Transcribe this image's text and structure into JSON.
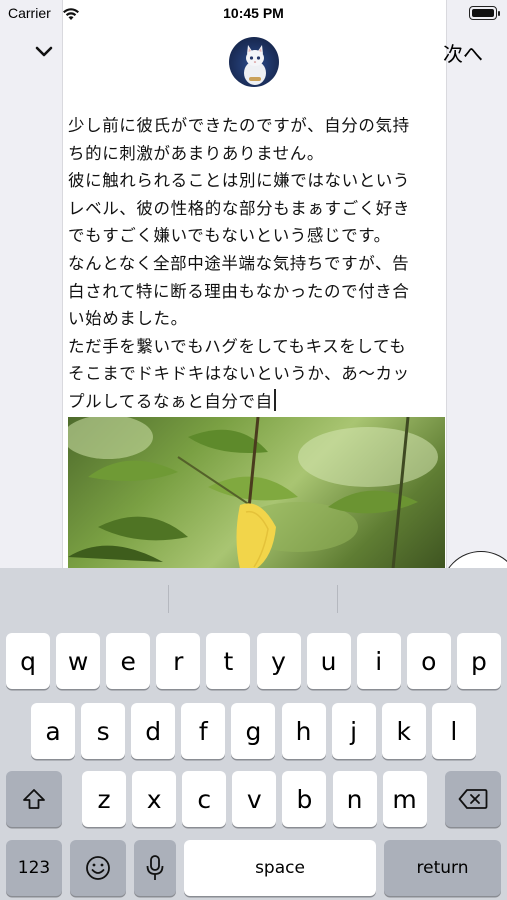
{
  "status_bar": {
    "carrier": "Carrier",
    "time": "10:45 PM"
  },
  "nav": {
    "next_label": "次へ"
  },
  "post": {
    "lines": [
      "少し前に彼氏ができたのですが、自分の気持",
      "ち的に刺激があまりありません。",
      "彼に触れられることは別に嫌ではないという",
      "レベル、彼の性格的な部分もまぁすごく好き",
      "でもすごく嫌いでもないという感じです。",
      "なんとなく全部中途半端な気持ちですが、告",
      "白されて特に断る理由もなかったので付き合",
      "い始めました。",
      "ただ手を繋いでもハグをしてもキスをしても",
      "そこまでドキドキはないというか、あ〜カッ",
      "プルしてるなぁと自分で自"
    ]
  },
  "keyboard": {
    "row1": [
      "q",
      "w",
      "e",
      "r",
      "t",
      "y",
      "u",
      "i",
      "o",
      "p"
    ],
    "row2": [
      "a",
      "s",
      "d",
      "f",
      "g",
      "h",
      "j",
      "k",
      "l"
    ],
    "row3": [
      "z",
      "x",
      "c",
      "v",
      "b",
      "n",
      "m"
    ],
    "numbers_label": "123",
    "space_label": "space",
    "return_label": "return"
  }
}
